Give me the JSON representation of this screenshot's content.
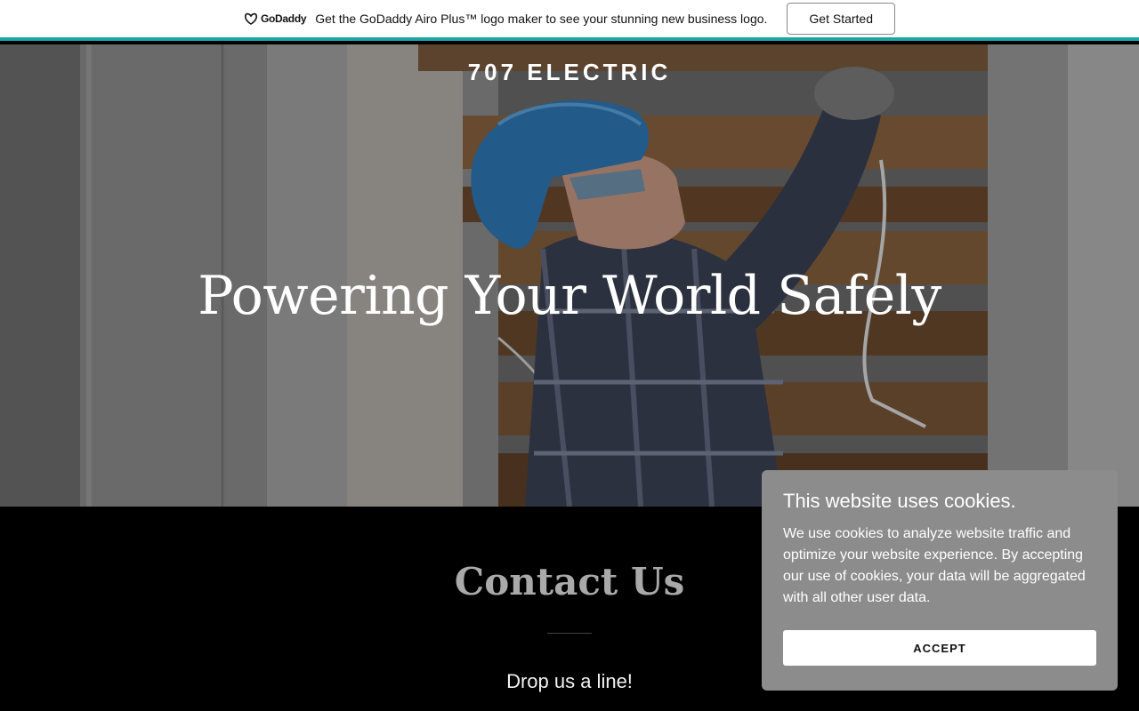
{
  "promo": {
    "logo_text": "GoDaddy",
    "message": "Get the GoDaddy Airo Plus™ logo maker to see your stunning new business logo.",
    "button_label": "Get Started",
    "accent_color": "#1ba6a6"
  },
  "hero": {
    "brand": "707 ELECTRIC",
    "title": "Powering Your World Safely"
  },
  "contact": {
    "title": "Contact Us",
    "subtitle": "Drop us a line!"
  },
  "cookie": {
    "title": "This website uses cookies.",
    "body": "We use cookies to analyze website traffic and optimize your website experience. By accepting our use of cookies, your data will be aggregated with all other user data.",
    "accept_label": "ACCEPT"
  }
}
